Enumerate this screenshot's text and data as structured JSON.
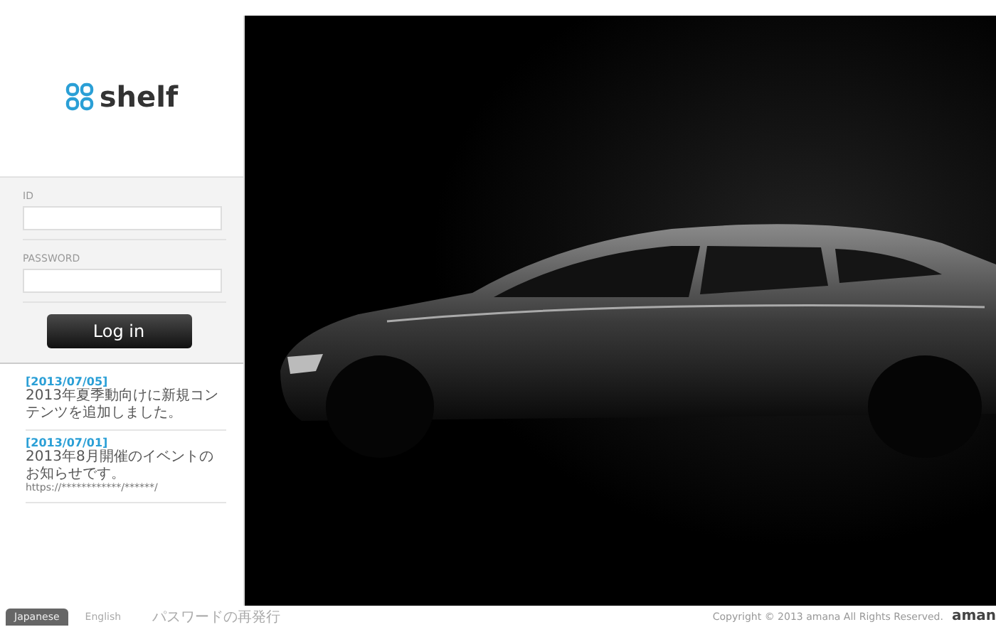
{
  "logo": {
    "text": "shelf"
  },
  "login": {
    "fields": [
      {
        "label": "ID"
      },
      {
        "label": "PASSWORD"
      }
    ],
    "button": "Log in"
  },
  "news": [
    {
      "date": "[2013/07/05]",
      "text": "2013年夏季動向けに新規コンテンツを追加しました。"
    },
    {
      "date": "[2013/07/01]",
      "text": "2013年8月開催のイベントのお知らせです。",
      "link": "https://************/******/"
    }
  ],
  "footer": {
    "languages": [
      {
        "label": "Japanese",
        "selected": true
      },
      {
        "label": "English",
        "selected": false
      }
    ],
    "reset_link": "パスワードの再発行",
    "copyright": "Copyright © 2013 amana All Rights Reserved.",
    "brand": "aman"
  }
}
